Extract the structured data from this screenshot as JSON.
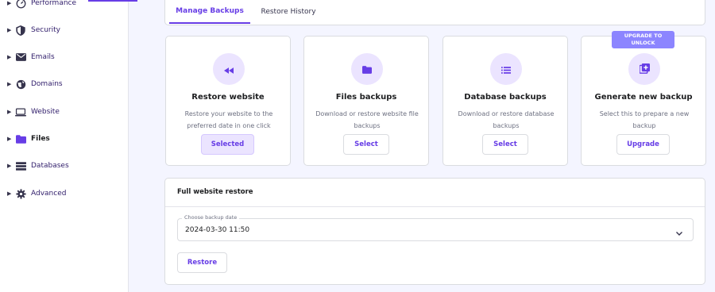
{
  "sidebar": {
    "items": [
      {
        "label": "Performance",
        "icon": "speedometer-icon"
      },
      {
        "label": "Security",
        "icon": "shield-icon"
      },
      {
        "label": "Emails",
        "icon": "envelope-icon"
      },
      {
        "label": "Domains",
        "icon": "globe-icon"
      },
      {
        "label": "Website",
        "icon": "laptop-icon"
      },
      {
        "label": "Files",
        "icon": "folder-icon"
      },
      {
        "label": "Databases",
        "icon": "database-icon"
      },
      {
        "label": "Advanced",
        "icon": "gear-icon"
      }
    ],
    "active": "Files"
  },
  "tabs": [
    {
      "label": "Manage Backups",
      "active": true
    },
    {
      "label": "Restore History",
      "active": false
    }
  ],
  "options": [
    {
      "title": "Restore website",
      "desc": "Restore your website to the preferred date in one click",
      "button": "Selected",
      "icon": "rewind-icon"
    },
    {
      "title": "Files backups",
      "desc": "Download or restore website file backups",
      "button": "Select",
      "icon": "folder-icon"
    },
    {
      "title": "Database backups",
      "desc": "Download or restore database backups",
      "button": "Select",
      "icon": "list-icon"
    },
    {
      "title": "Generate new backup",
      "desc": "Select this to prepare a new backup",
      "button": "Upgrade",
      "icon": "add-copy-icon",
      "badge": "UPGRADE TO UNLOCK"
    }
  ],
  "restore_panel": {
    "title": "Full website restore",
    "date_label": "Choose backup date",
    "date_value": "2024-03-30 11:50",
    "button": "Restore"
  },
  "colors": {
    "accent": "#673de6",
    "accent_light": "#ebe4ff",
    "badge": "#8c85ff",
    "background": "#f4f5ff"
  }
}
